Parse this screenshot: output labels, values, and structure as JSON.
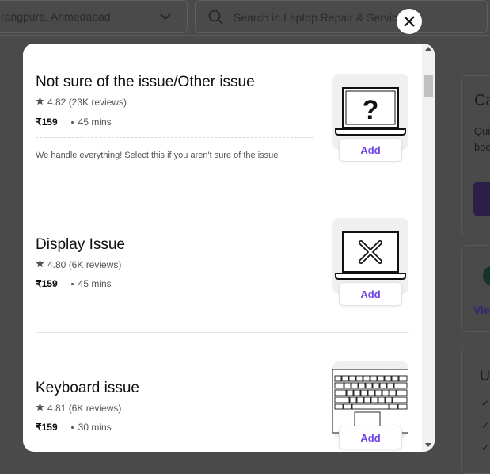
{
  "header": {
    "location": "rangpura, Ahmedabad",
    "search_placeholder": "Search in Laptop Repair & Services"
  },
  "background": {
    "card_title_partial": "Ca",
    "card_line1_partial": "Qui",
    "card_line2_partial": "boo",
    "view_partial": "Vie",
    "list_heading_partial": "U"
  },
  "modal": {
    "services": [
      {
        "title": "Not sure of the issue/Other issue",
        "rating": "4.82 (23K reviews)",
        "price": "₹159",
        "duration": "45 mins",
        "description": "We handle everything! Select this if you aren't sure of the issue",
        "add_label": "Add",
        "icon": "laptop-question-icon"
      },
      {
        "title": "Display Issue",
        "rating": "4.80 (6K reviews)",
        "price": "₹159",
        "duration": "45 mins",
        "add_label": "Add",
        "icon": "laptop-x-icon"
      },
      {
        "title": "Keyboard issue",
        "rating": "4.81 (6K reviews)",
        "price": "₹159",
        "duration": "30 mins",
        "add_label": "Add",
        "icon": "keyboard-icon"
      }
    ]
  },
  "colors": {
    "accent": "#6e42e5",
    "overlay": "#4a4a4a"
  }
}
